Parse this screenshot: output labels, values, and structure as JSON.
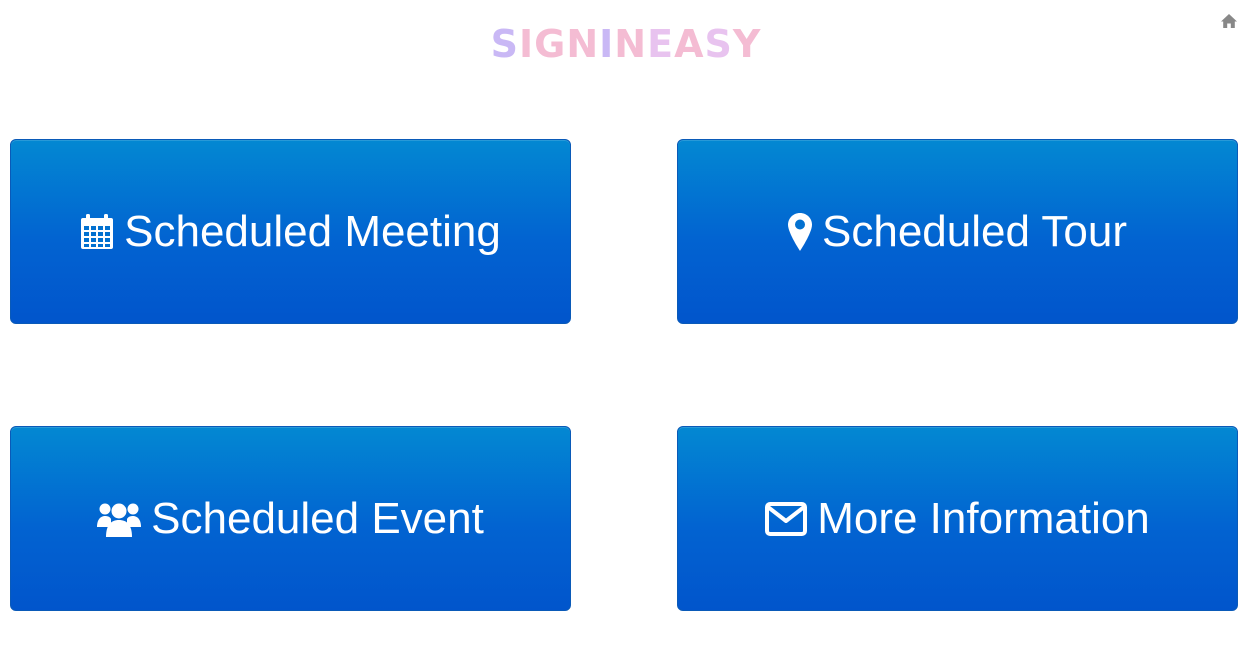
{
  "header": {
    "logo_text": "SIGNINEASY",
    "logo_colors": [
      "#c9b8f5",
      "#f4bcd3",
      "#f4bcd3",
      "#f4bcd3",
      "#c9b8f5",
      "#f4bcd3",
      "#e8c3ef",
      "#f4bcd3",
      "#e8c3ef",
      "#f4bcd3"
    ],
    "home_icon": "home-icon"
  },
  "tiles": [
    {
      "label": "Scheduled Meeting",
      "icon": "calendar-icon"
    },
    {
      "label": "Scheduled Tour",
      "icon": "map-marker-icon"
    },
    {
      "label": "Scheduled Event",
      "icon": "users-icon"
    },
    {
      "label": "More Information",
      "icon": "envelope-icon"
    }
  ],
  "colors": {
    "tile_gradient_top": "#0388d2",
    "tile_gradient_bottom": "#0155cc",
    "tile_text": "#ffffff",
    "home_icon": "#888888"
  }
}
